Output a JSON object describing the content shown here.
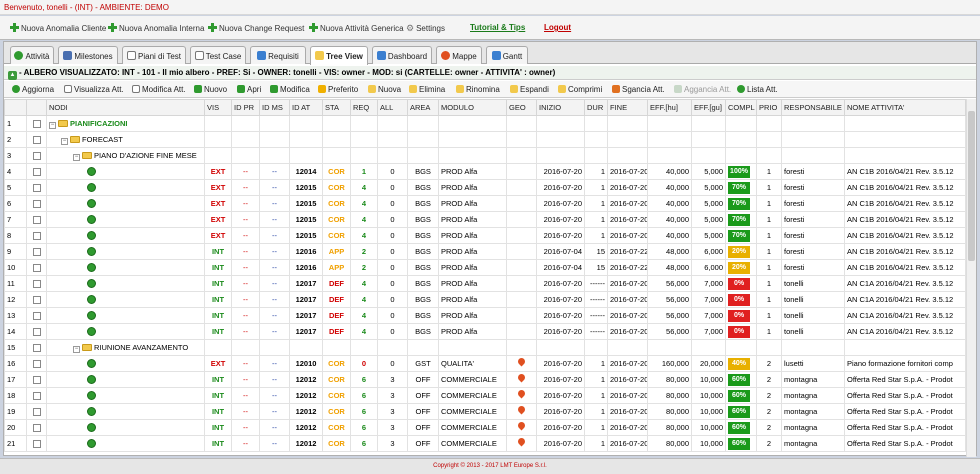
{
  "window": {
    "title": "Benvenuto, tonelli - (INT) - AMBIENTE: DEMO"
  },
  "menu": {
    "nuova_anomalia_cliente": "Nuova Anomalia Cliente",
    "nuova_anomalia_interna": "Nuova Anomalia Interna",
    "nuova_change_request": "Nuova Change Request",
    "nuova_attivita_generica": "Nuova Attività Generica",
    "settings": "Settings",
    "tutorial": "Tutorial & Tips",
    "logout": "Logout"
  },
  "tabs": [
    {
      "label": "Attività",
      "icon": "activity-icon"
    },
    {
      "label": "Milestones",
      "icon": "calendar-icon"
    },
    {
      "label": "Piani di Test",
      "icon": "document-icon"
    },
    {
      "label": "Test Case",
      "icon": "document-icon"
    },
    {
      "label": "Requisiti",
      "icon": "list-icon"
    },
    {
      "label": "Tree View",
      "icon": "folder-icon"
    },
    {
      "label": "Dashboard",
      "icon": "dashboard-icon"
    },
    {
      "label": "Mappe",
      "icon": "map-pin-icon"
    },
    {
      "label": "Gantt",
      "icon": "gantt-icon"
    }
  ],
  "tree_info": "- ALBERO VISUALIZZATO: INT - 101 - Il mio albero - PREF: Si - OWNER: tonelli - VIS: owner - MOD: si (CARTELLE: owner - ATTIVITA' : owner)",
  "toolbar": {
    "aggiorna": "Aggiorna",
    "visualizza": "Visualizza Att.",
    "modifica_att": "Modifica Att.",
    "nuovo": "Nuovo",
    "apri": "Apri",
    "modifica": "Modifica",
    "preferito": "Preferito",
    "nuova": "Nuova",
    "elimina": "Elimina",
    "rinomina": "Rinomina",
    "espandi": "Espandi",
    "comprimi": "Comprimi",
    "sgancia": "Sgancia Att.",
    "aggancia": "Aggancia Att.",
    "lista": "Lista Att."
  },
  "columns": [
    "NODI",
    "VIS",
    "ID PR",
    "ID MS",
    "ID AT",
    "STA",
    "REQ",
    "ALL",
    "AREA",
    "MODULO",
    "GEO",
    "INIZIO",
    "DUR",
    "FINE",
    "EFF.[hu]",
    "EFF.[gu]",
    "COMPL",
    "PRIO",
    "RESPONSABILE",
    "NOME ATTIVITA'"
  ],
  "colors": {
    "ext": "#d00000",
    "int": "#1a8a1a",
    "cor": "#f0a000",
    "def": "#d00000",
    "compl_green": "#1a9a1a",
    "compl_red": "#e02020",
    "compl_orange": "#e8b000"
  },
  "rows": [
    {
      "n": "1",
      "type": "folder",
      "level": 0,
      "label": "PIANIFICAZIONI"
    },
    {
      "n": "2",
      "type": "folder",
      "level": 1,
      "label": "FORECAST"
    },
    {
      "n": "3",
      "type": "folder",
      "level": 2,
      "label": "PIANO D'AZIONE FINE MESE"
    },
    {
      "n": "4",
      "type": "task",
      "vis": "EXT",
      "idpr": "--",
      "idms": "--",
      "idat": "12014",
      "sta": "COR",
      "req": "1",
      "all": "0",
      "area": "BGS",
      "modulo": "PROD Alfa",
      "geo": "",
      "inizio": "2016-07-20",
      "dur": "1",
      "fine": "2016-07-20",
      "effhu": "40,000",
      "effgu": "5,000",
      "compl": "100%",
      "cc": "green",
      "prio": "1",
      "resp": "foresti",
      "nome": "AN C1B 2016/04/21 Rev. 3.5.12"
    },
    {
      "n": "5",
      "type": "task",
      "vis": "EXT",
      "idpr": "--",
      "idms": "--",
      "idat": "12015",
      "sta": "COR",
      "req": "4",
      "all": "0",
      "area": "BGS",
      "modulo": "PROD Alfa",
      "geo": "",
      "inizio": "2016-07-20",
      "dur": "1",
      "fine": "2016-07-20",
      "effhu": "40,000",
      "effgu": "5,000",
      "compl": "70%",
      "cc": "green",
      "prio": "1",
      "resp": "foresti",
      "nome": "AN C1B 2016/04/21 Rev. 3.5.12"
    },
    {
      "n": "6",
      "type": "task",
      "vis": "EXT",
      "idpr": "--",
      "idms": "--",
      "idat": "12015",
      "sta": "COR",
      "req": "4",
      "all": "0",
      "area": "BGS",
      "modulo": "PROD Alfa",
      "geo": "",
      "inizio": "2016-07-20",
      "dur": "1",
      "fine": "2016-07-20",
      "effhu": "40,000",
      "effgu": "5,000",
      "compl": "70%",
      "cc": "green",
      "prio": "1",
      "resp": "foresti",
      "nome": "AN C1B 2016/04/21 Rev. 3.5.12"
    },
    {
      "n": "7",
      "type": "task",
      "vis": "EXT",
      "idpr": "--",
      "idms": "--",
      "idat": "12015",
      "sta": "COR",
      "req": "4",
      "all": "0",
      "area": "BGS",
      "modulo": "PROD Alfa",
      "geo": "",
      "inizio": "2016-07-20",
      "dur": "1",
      "fine": "2016-07-20",
      "effhu": "40,000",
      "effgu": "5,000",
      "compl": "70%",
      "cc": "green",
      "prio": "1",
      "resp": "foresti",
      "nome": "AN C1B 2016/04/21 Rev. 3.5.12"
    },
    {
      "n": "8",
      "type": "task",
      "vis": "EXT",
      "idpr": "--",
      "idms": "--",
      "idat": "12015",
      "sta": "COR",
      "req": "4",
      "all": "0",
      "area": "BGS",
      "modulo": "PROD Alfa",
      "geo": "",
      "inizio": "2016-07-20",
      "dur": "1",
      "fine": "2016-07-20",
      "effhu": "40,000",
      "effgu": "5,000",
      "compl": "70%",
      "cc": "green",
      "prio": "1",
      "resp": "foresti",
      "nome": "AN C1B 2016/04/21 Rev. 3.5.12"
    },
    {
      "n": "9",
      "type": "task",
      "vis": "INT",
      "idpr": "--",
      "idms": "--",
      "idat": "12016",
      "sta": "APP",
      "req": "2",
      "all": "0",
      "area": "BGS",
      "modulo": "PROD Alfa",
      "geo": "",
      "inizio": "2016-07-04",
      "dur": "15",
      "fine": "2016-07-22",
      "effhu": "48,000",
      "effgu": "6,000",
      "compl": "20%",
      "cc": "orange",
      "prio": "1",
      "resp": "foresti",
      "nome": "AN C1B 2016/04/21 Rev. 3.5.12"
    },
    {
      "n": "10",
      "type": "task",
      "vis": "INT",
      "idpr": "--",
      "idms": "--",
      "idat": "12016",
      "sta": "APP",
      "req": "2",
      "all": "0",
      "area": "BGS",
      "modulo": "PROD Alfa",
      "geo": "",
      "inizio": "2016-07-04",
      "dur": "15",
      "fine": "2016-07-22",
      "effhu": "48,000",
      "effgu": "6,000",
      "compl": "20%",
      "cc": "orange",
      "prio": "1",
      "resp": "foresti",
      "nome": "AN C1B 2016/04/21 Rev. 3.5.12"
    },
    {
      "n": "11",
      "type": "task",
      "vis": "INT",
      "idpr": "--",
      "idms": "--",
      "idat": "12017",
      "sta": "DEF",
      "req": "4",
      "all": "0",
      "area": "BGS",
      "modulo": "PROD Alfa",
      "geo": "",
      "inizio": "2016-07-20",
      "dur": "------",
      "fine": "2016-07-20",
      "effhu": "56,000",
      "effgu": "7,000",
      "compl": "0%",
      "cc": "red",
      "prio": "1",
      "resp": "tonelli",
      "nome": "AN C1A 2016/04/21 Rev. 3.5.12"
    },
    {
      "n": "12",
      "type": "task",
      "vis": "INT",
      "idpr": "--",
      "idms": "--",
      "idat": "12017",
      "sta": "DEF",
      "req": "4",
      "all": "0",
      "area": "BGS",
      "modulo": "PROD Alfa",
      "geo": "",
      "inizio": "2016-07-20",
      "dur": "------",
      "fine": "2016-07-20",
      "effhu": "56,000",
      "effgu": "7,000",
      "compl": "0%",
      "cc": "red",
      "prio": "1",
      "resp": "tonelli",
      "nome": "AN C1A 2016/04/21 Rev. 3.5.12"
    },
    {
      "n": "13",
      "type": "task",
      "vis": "INT",
      "idpr": "--",
      "idms": "--",
      "idat": "12017",
      "sta": "DEF",
      "req": "4",
      "all": "0",
      "area": "BGS",
      "modulo": "PROD Alfa",
      "geo": "",
      "inizio": "2016-07-20",
      "dur": "------",
      "fine": "2016-07-20",
      "effhu": "56,000",
      "effgu": "7,000",
      "compl": "0%",
      "cc": "red",
      "prio": "1",
      "resp": "tonelli",
      "nome": "AN C1A 2016/04/21 Rev. 3.5.12"
    },
    {
      "n": "14",
      "type": "task",
      "vis": "INT",
      "idpr": "--",
      "idms": "--",
      "idat": "12017",
      "sta": "DEF",
      "req": "4",
      "all": "0",
      "area": "BGS",
      "modulo": "PROD Alfa",
      "geo": "",
      "inizio": "2016-07-20",
      "dur": "------",
      "fine": "2016-07-20",
      "effhu": "56,000",
      "effgu": "7,000",
      "compl": "0%",
      "cc": "red",
      "prio": "1",
      "resp": "tonelli",
      "nome": "AN C1A 2016/04/21 Rev. 3.5.12"
    },
    {
      "n": "15",
      "type": "folder",
      "level": 2,
      "label": "RIUNIONE AVANZAMENTO"
    },
    {
      "n": "16",
      "type": "task",
      "vis": "EXT",
      "idpr": "--",
      "idms": "--",
      "idat": "12010",
      "sta": "COR",
      "req": "0",
      "all": "0",
      "area": "GST",
      "modulo": "QUALITA'",
      "geo": "pin",
      "inizio": "2016-07-20",
      "dur": "1",
      "fine": "2016-07-20",
      "effhu": "160,000",
      "effgu": "20,000",
      "compl": "40%",
      "cc": "orange",
      "prio": "2",
      "resp": "lusetti",
      "nome": "Piano formazione fornitori comp"
    },
    {
      "n": "17",
      "type": "task",
      "vis": "INT",
      "idpr": "--",
      "idms": "--",
      "idat": "12012",
      "sta": "COR",
      "req": "6",
      "all": "3",
      "area": "OFF",
      "modulo": "COMMERCIALE",
      "geo": "pin",
      "inizio": "2016-07-20",
      "dur": "1",
      "fine": "2016-07-20",
      "effhu": "80,000",
      "effgu": "10,000",
      "compl": "60%",
      "cc": "green",
      "prio": "2",
      "resp": "montagna",
      "nome": "Offerta Red Star S.p.A. - Prodot"
    },
    {
      "n": "18",
      "type": "task",
      "vis": "INT",
      "idpr": "--",
      "idms": "--",
      "idat": "12012",
      "sta": "COR",
      "req": "6",
      "all": "3",
      "area": "OFF",
      "modulo": "COMMERCIALE",
      "geo": "pin",
      "inizio": "2016-07-20",
      "dur": "1",
      "fine": "2016-07-20",
      "effhu": "80,000",
      "effgu": "10,000",
      "compl": "60%",
      "cc": "green",
      "prio": "2",
      "resp": "montagna",
      "nome": "Offerta Red Star S.p.A. - Prodot"
    },
    {
      "n": "19",
      "type": "task",
      "vis": "INT",
      "idpr": "--",
      "idms": "--",
      "idat": "12012",
      "sta": "COR",
      "req": "6",
      "all": "3",
      "area": "OFF",
      "modulo": "COMMERCIALE",
      "geo": "pin",
      "inizio": "2016-07-20",
      "dur": "1",
      "fine": "2016-07-20",
      "effhu": "80,000",
      "effgu": "10,000",
      "compl": "60%",
      "cc": "green",
      "prio": "2",
      "resp": "montagna",
      "nome": "Offerta Red Star S.p.A. - Prodot"
    },
    {
      "n": "20",
      "type": "task",
      "vis": "INT",
      "idpr": "--",
      "idms": "--",
      "idat": "12012",
      "sta": "COR",
      "req": "6",
      "all": "3",
      "area": "OFF",
      "modulo": "COMMERCIALE",
      "geo": "pin",
      "inizio": "2016-07-20",
      "dur": "1",
      "fine": "2016-07-20",
      "effhu": "80,000",
      "effgu": "10,000",
      "compl": "60%",
      "cc": "green",
      "prio": "2",
      "resp": "montagna",
      "nome": "Offerta Red Star S.p.A. - Prodot"
    },
    {
      "n": "21",
      "type": "task",
      "vis": "INT",
      "idpr": "--",
      "idms": "--",
      "idat": "12012",
      "sta": "COR",
      "req": "6",
      "all": "3",
      "area": "OFF",
      "modulo": "COMMERCIALE",
      "geo": "pin",
      "inizio": "2016-07-20",
      "dur": "1",
      "fine": "2016-07-20",
      "effhu": "80,000",
      "effgu": "10,000",
      "compl": "60%",
      "cc": "green",
      "prio": "2",
      "resp": "montagna",
      "nome": "Offerta Red Star S.p.A. - Prodot"
    }
  ],
  "footer": "Copyright © 2013 - 2017 LMT Europe S.r.l."
}
